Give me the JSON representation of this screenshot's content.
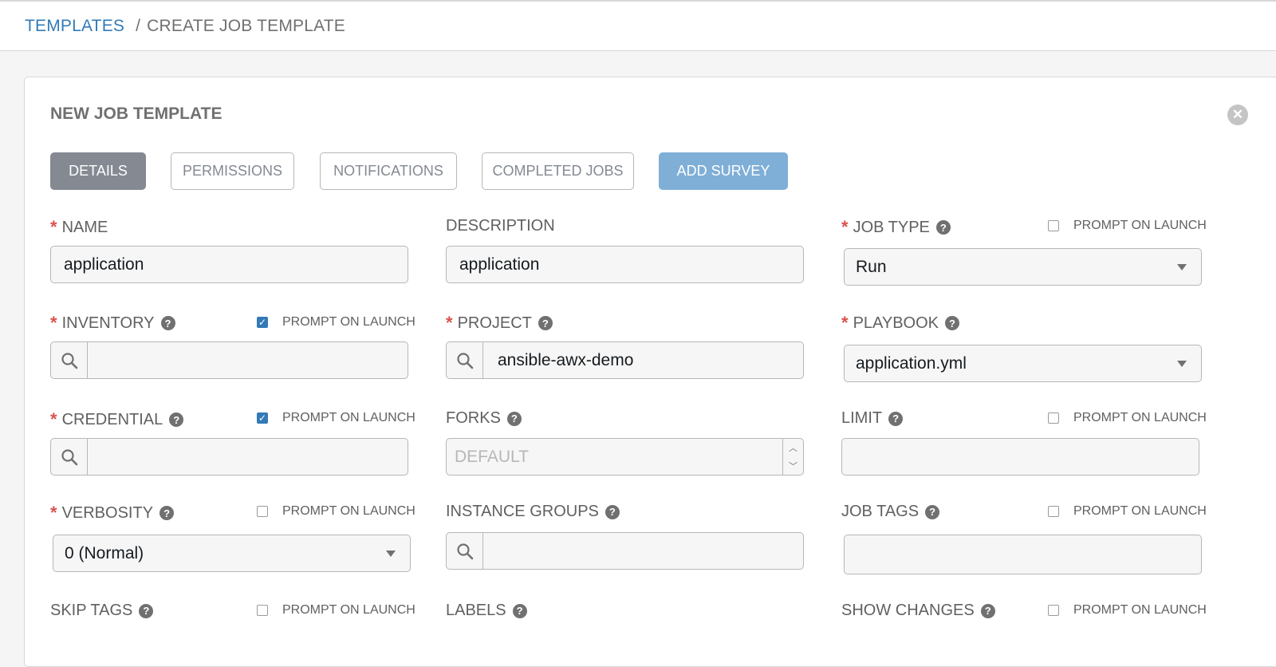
{
  "breadcrumb": {
    "link": "TEMPLATES",
    "separator": "/",
    "current": "CREATE JOB TEMPLATE"
  },
  "panel": {
    "title": "NEW JOB TEMPLATE",
    "close_icon": "times-circle-icon"
  },
  "tabs": [
    {
      "label": "DETAILS",
      "active": true
    },
    {
      "label": "PERMISSIONS",
      "active": false
    },
    {
      "label": "NOTIFICATIONS",
      "active": false
    },
    {
      "label": "COMPLETED JOBS",
      "active": false
    },
    {
      "label": "ADD SURVEY",
      "active": false
    }
  ],
  "prompt_label": "PROMPT ON LAUNCH",
  "fields": {
    "name": {
      "label": "NAME",
      "required": true,
      "value": "application"
    },
    "description": {
      "label": "DESCRIPTION",
      "value": "application"
    },
    "job_type": {
      "label": "JOB TYPE",
      "required": true,
      "value": "Run",
      "prompt_on_launch": false
    },
    "inventory": {
      "label": "INVENTORY",
      "required": true,
      "value": "",
      "prompt_on_launch": true
    },
    "project": {
      "label": "PROJECT",
      "required": true,
      "value": "ansible-awx-demo"
    },
    "playbook": {
      "label": "PLAYBOOK",
      "required": true,
      "value": "application.yml"
    },
    "credential": {
      "label": "CREDENTIAL",
      "required": true,
      "value": "",
      "prompt_on_launch": true
    },
    "forks": {
      "label": "FORKS",
      "placeholder": "DEFAULT"
    },
    "limit": {
      "label": "LIMIT",
      "value": "",
      "prompt_on_launch": false
    },
    "verbosity": {
      "label": "VERBOSITY",
      "required": true,
      "value": "0 (Normal)",
      "prompt_on_launch": false
    },
    "instance_groups": {
      "label": "INSTANCE GROUPS",
      "value": ""
    },
    "job_tags": {
      "label": "JOB TAGS",
      "value": "",
      "prompt_on_launch": false
    },
    "skip_tags": {
      "label": "SKIP TAGS",
      "prompt_on_launch": false
    },
    "labels": {
      "label": "LABELS"
    },
    "show_changes": {
      "label": "SHOW CHANGES",
      "prompt_on_launch": false
    }
  },
  "colors": {
    "link": "#337ab7",
    "required": "#d9534f",
    "tab_active": "#848992",
    "survey_button": "#7fafd7"
  }
}
